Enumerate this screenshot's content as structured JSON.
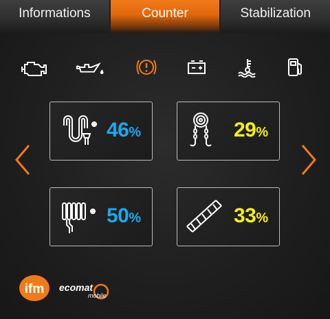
{
  "tabs": [
    {
      "label": "Informations",
      "active": false
    },
    {
      "label": "Counter",
      "active": true
    },
    {
      "label": "Stabilization",
      "active": false
    }
  ],
  "status_icons": [
    {
      "name": "engine-icon",
      "color": "#ffffff"
    },
    {
      "name": "oil-can-icon",
      "color": "#ffffff"
    },
    {
      "name": "brake-warning-icon",
      "color": "#f07a1a"
    },
    {
      "name": "battery-icon",
      "color": "#ffffff"
    },
    {
      "name": "coolant-temperature-icon",
      "color": "#ffffff"
    },
    {
      "name": "fuel-pump-icon",
      "color": "#ffffff"
    }
  ],
  "counters": [
    {
      "icon": "hose-reel-icon",
      "value": "46",
      "unit": "%",
      "color": "#1ba8ee"
    },
    {
      "icon": "hook-chain-icon",
      "value": "29",
      "unit": "%",
      "color": "#f5ef16"
    },
    {
      "icon": "radiator-valve-icon",
      "value": "50",
      "unit": "%",
      "color": "#1ba8ee"
    },
    {
      "icon": "ladder-icon",
      "value": "33",
      "unit": "%",
      "color": "#f5ef16"
    }
  ],
  "nav": {
    "prev": "chevron-left-icon",
    "next": "chevron-right-icon",
    "color": "#f07a1a"
  },
  "brand": {
    "logo1_text": "ifm",
    "logo2_text": "ecomat",
    "logo2_sub": "mobile",
    "accent": "#f07a1a"
  }
}
